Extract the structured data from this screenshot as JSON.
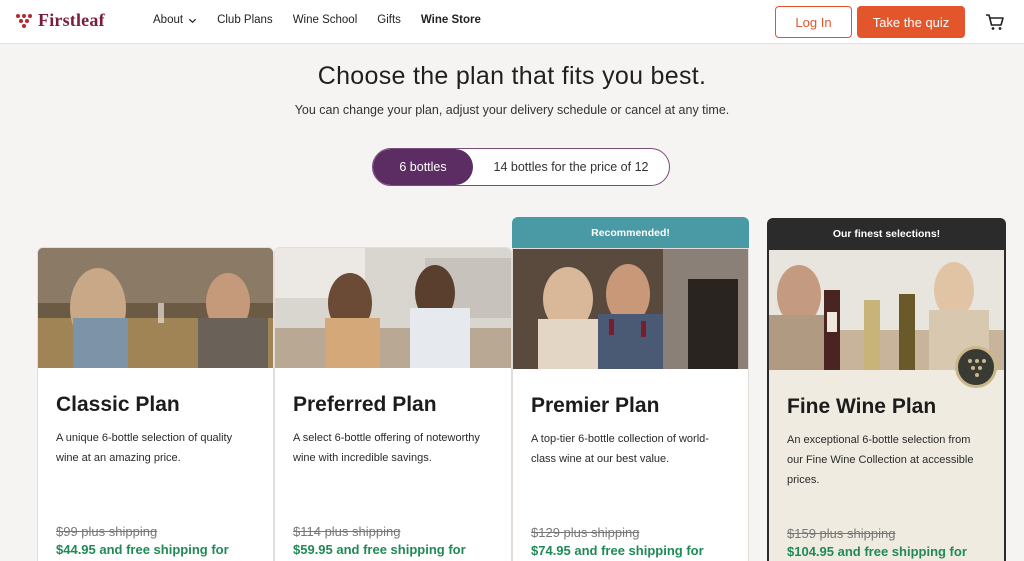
{
  "header": {
    "logo_text": "Firstleaf",
    "nav": [
      {
        "label": "About",
        "has_dropdown": true
      },
      {
        "label": "Club Plans"
      },
      {
        "label": "Wine School"
      },
      {
        "label": "Gifts"
      },
      {
        "label": "Wine Store"
      }
    ],
    "login_label": "Log In",
    "quiz_label": "Take the quiz",
    "cart_icon": "cart-icon"
  },
  "hero": {
    "title": "Choose the plan that fits you best.",
    "subtitle": "You can change your plan, adjust your delivery schedule or cancel at any time."
  },
  "toggle": {
    "active": "6 bottles",
    "inactive": "14 bottles for the price of 12"
  },
  "plans": [
    {
      "title": "Classic Plan",
      "description": "A unique 6-bottle selection of quality wine at an amazing price.",
      "old_price": "$99 plus shipping",
      "new_price": "$44.95 and free shipping for"
    },
    {
      "title": "Preferred Plan",
      "description": "A select 6-bottle offering of noteworthy wine with incredible savings.",
      "old_price": "$114 plus shipping",
      "new_price": "$59.95 and free shipping for"
    },
    {
      "title": "Premier Plan",
      "banner": "Recommended!",
      "description": "A top-tier 6-bottle collection of world-class wine at our best value.",
      "old_price": "$129 plus shipping",
      "new_price": "$74.95 and free shipping for"
    },
    {
      "title": "Fine Wine Plan",
      "banner": "Our finest selections!",
      "description": "An exceptional 6-bottle selection from our Fine Wine Collection at accessible prices.",
      "old_price": "$159 plus shipping",
      "new_price": "$104.95 and free shipping for"
    }
  ],
  "colors": {
    "brand": "#7a1c3b",
    "accent": "#e3562c",
    "toggle_active": "#5c2d62",
    "recommended": "#4a9aa5",
    "price_green": "#1f8a56"
  }
}
